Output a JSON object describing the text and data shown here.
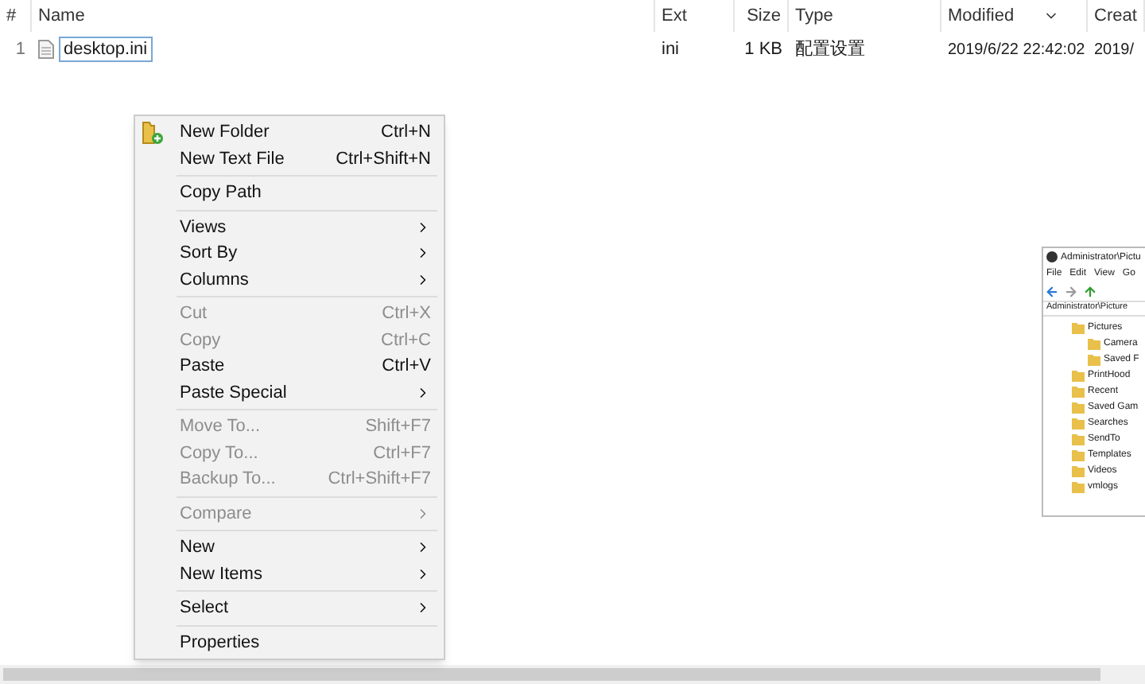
{
  "table": {
    "columns": [
      {
        "label": "#"
      },
      {
        "label": "Name"
      },
      {
        "label": "Ext"
      },
      {
        "label": "Size"
      },
      {
        "label": "Type"
      },
      {
        "label": "Modified",
        "sorted": true
      },
      {
        "label": "Creat"
      }
    ],
    "rows": [
      {
        "index": "1",
        "name": "desktop.ini",
        "ext": "ini",
        "size": "1 KB",
        "type": "配置设置",
        "modified": "2019/6/22 22:42:02",
        "created": "2019/",
        "editing": true
      }
    ]
  },
  "context_menu": {
    "items": [
      {
        "kind": "item",
        "label": "New Folder",
        "shortcut": "Ctrl+N",
        "disabled": false,
        "submenu": false,
        "has_icon": true
      },
      {
        "kind": "item",
        "label": "New Text File",
        "shortcut": "Ctrl+Shift+N",
        "disabled": false,
        "submenu": false,
        "has_icon": false
      },
      {
        "kind": "separator"
      },
      {
        "kind": "item",
        "label": "Copy Path",
        "disabled": false,
        "submenu": false,
        "has_icon": false
      },
      {
        "kind": "separator"
      },
      {
        "kind": "item",
        "label": "Views",
        "disabled": false,
        "submenu": true,
        "has_icon": false
      },
      {
        "kind": "item",
        "label": "Sort By",
        "disabled": false,
        "submenu": true,
        "has_icon": false
      },
      {
        "kind": "item",
        "label": "Columns",
        "disabled": false,
        "submenu": true,
        "has_icon": false
      },
      {
        "kind": "separator"
      },
      {
        "kind": "item",
        "label": "Cut",
        "shortcut": "Ctrl+X",
        "disabled": true,
        "submenu": false,
        "has_icon": false
      },
      {
        "kind": "item",
        "label": "Copy",
        "shortcut": "Ctrl+C",
        "disabled": true,
        "submenu": false,
        "has_icon": false
      },
      {
        "kind": "item",
        "label": "Paste",
        "shortcut": "Ctrl+V",
        "disabled": false,
        "submenu": false,
        "has_icon": false
      },
      {
        "kind": "item",
        "label": "Paste Special",
        "disabled": false,
        "submenu": true,
        "has_icon": false
      },
      {
        "kind": "separator"
      },
      {
        "kind": "item",
        "label": "Move To...",
        "shortcut": "Shift+F7",
        "disabled": true,
        "submenu": false,
        "has_icon": false
      },
      {
        "kind": "item",
        "label": "Copy To...",
        "shortcut": "Ctrl+F7",
        "disabled": true,
        "submenu": false,
        "has_icon": false
      },
      {
        "kind": "item",
        "label": "Backup To...",
        "shortcut": "Ctrl+Shift+F7",
        "disabled": true,
        "submenu": false,
        "has_icon": false
      },
      {
        "kind": "separator"
      },
      {
        "kind": "item",
        "label": "Compare",
        "disabled": true,
        "submenu": true,
        "has_icon": false
      },
      {
        "kind": "separator"
      },
      {
        "kind": "item",
        "label": "New",
        "disabled": false,
        "submenu": true,
        "has_icon": false
      },
      {
        "kind": "item",
        "label": "New Items",
        "disabled": false,
        "submenu": true,
        "has_icon": false
      },
      {
        "kind": "separator"
      },
      {
        "kind": "item",
        "label": "Select",
        "disabled": false,
        "submenu": true,
        "has_icon": false
      },
      {
        "kind": "separator"
      },
      {
        "kind": "item",
        "label": "Properties",
        "disabled": false,
        "submenu": false,
        "has_icon": false
      }
    ]
  },
  "mini_window": {
    "title": "Administrator\\Pictu",
    "menu": [
      "File",
      "Edit",
      "View",
      "Go"
    ],
    "address": "Administrator\\Picture",
    "tree": [
      {
        "label": "Pictures",
        "children": [
          {
            "label": "Camera"
          },
          {
            "label": "Saved F"
          }
        ]
      },
      {
        "label": "PrintHood"
      },
      {
        "label": "Recent"
      },
      {
        "label": "Saved Gam"
      },
      {
        "label": "Searches"
      },
      {
        "label": "SendTo"
      },
      {
        "label": "Templates"
      },
      {
        "label": "Videos"
      },
      {
        "label": "vmlogs"
      }
    ]
  }
}
